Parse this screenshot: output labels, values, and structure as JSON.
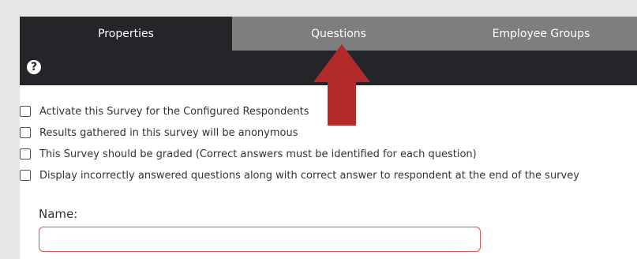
{
  "tabs": [
    {
      "label": "Properties"
    },
    {
      "label": "Questions"
    },
    {
      "label": "Employee Groups"
    }
  ],
  "toolbar": {
    "help_icon": "?"
  },
  "options": [
    {
      "label": "Activate this Survey for the Configured Respondents",
      "checked": false
    },
    {
      "label": "Results gathered in this survey will be anonymous",
      "checked": false
    },
    {
      "label": "This Survey should be graded (Correct answers must be identified for each question)",
      "checked": false
    },
    {
      "label": "Display incorrectly answered questions along with correct answer to respondent at the end of the survey",
      "checked": false
    }
  ],
  "name_field": {
    "label": "Name:",
    "value": ""
  },
  "colors": {
    "tab_active": "#232529",
    "tab_inactive": "#7e7e7e",
    "arrow": "#b22a2a",
    "input_border": "#d9534f"
  }
}
